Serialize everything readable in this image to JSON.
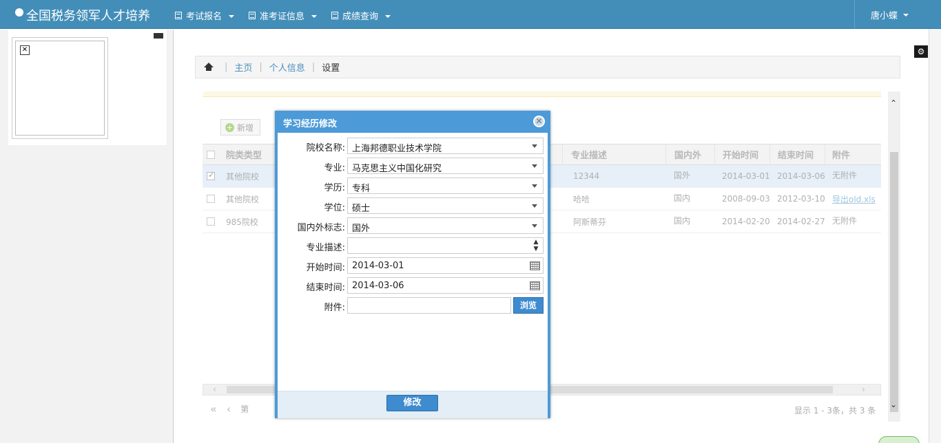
{
  "navbar": {
    "brand": "全国税务领军人才培养",
    "menu": [
      {
        "label": "考试报名"
      },
      {
        "label": "准考证信息"
      },
      {
        "label": "成绩查询"
      }
    ],
    "user": "唐小蝶",
    "bg_color": "#438eb9"
  },
  "breadcrumb": {
    "items": [
      "主页",
      "个人信息"
    ],
    "current": "设置"
  },
  "toolbar": {
    "add_label": "新增"
  },
  "grid": {
    "columns": [
      "院类类型",
      "专业描述",
      "国内外",
      "开始时间",
      "结束时间",
      "附件"
    ],
    "rows": [
      {
        "type": "其他院校",
        "desc": "12344",
        "region": "国外",
        "start": "2014-03-01",
        "end": "2014-03-06",
        "attach": "无附件",
        "selected": true
      },
      {
        "type": "其他院校",
        "desc": "哈哈",
        "region": "国内",
        "start": "2008-09-03",
        "end": "2012-03-10",
        "attach": "导出old.xls",
        "selected": false
      },
      {
        "type": "985院校",
        "desc": "阿斯蒂芬",
        "region": "国内",
        "start": "2014-02-20",
        "end": "2014-02-27",
        "attach": "无附件",
        "selected": false
      }
    ]
  },
  "pager": {
    "page_prefix": "第",
    "info": "显示 1 - 3条，共 3 条"
  },
  "modal": {
    "title": "学习经历修改",
    "fields": [
      {
        "label": "院校名称:",
        "value": "上海邦德职业技术学院",
        "kind": "select"
      },
      {
        "label": "专业:",
        "value": "马克思主义中国化研究",
        "kind": "select"
      },
      {
        "label": "学历:",
        "value": "专科",
        "kind": "select"
      },
      {
        "label": "学位:",
        "value": "硕士",
        "kind": "select"
      },
      {
        "label": "国内外标志:",
        "value": "国外",
        "kind": "select"
      },
      {
        "label": "专业描述:",
        "value": "",
        "kind": "spinner"
      },
      {
        "label": "开始时间:",
        "value": "2014-03-01",
        "kind": "date"
      },
      {
        "label": "结束时间:",
        "value": "2014-03-06",
        "kind": "date"
      },
      {
        "label": "附件:",
        "value": "",
        "kind": "file"
      }
    ],
    "browse_label": "浏览",
    "submit_label": "修改",
    "accent": "#4c9ad8"
  }
}
